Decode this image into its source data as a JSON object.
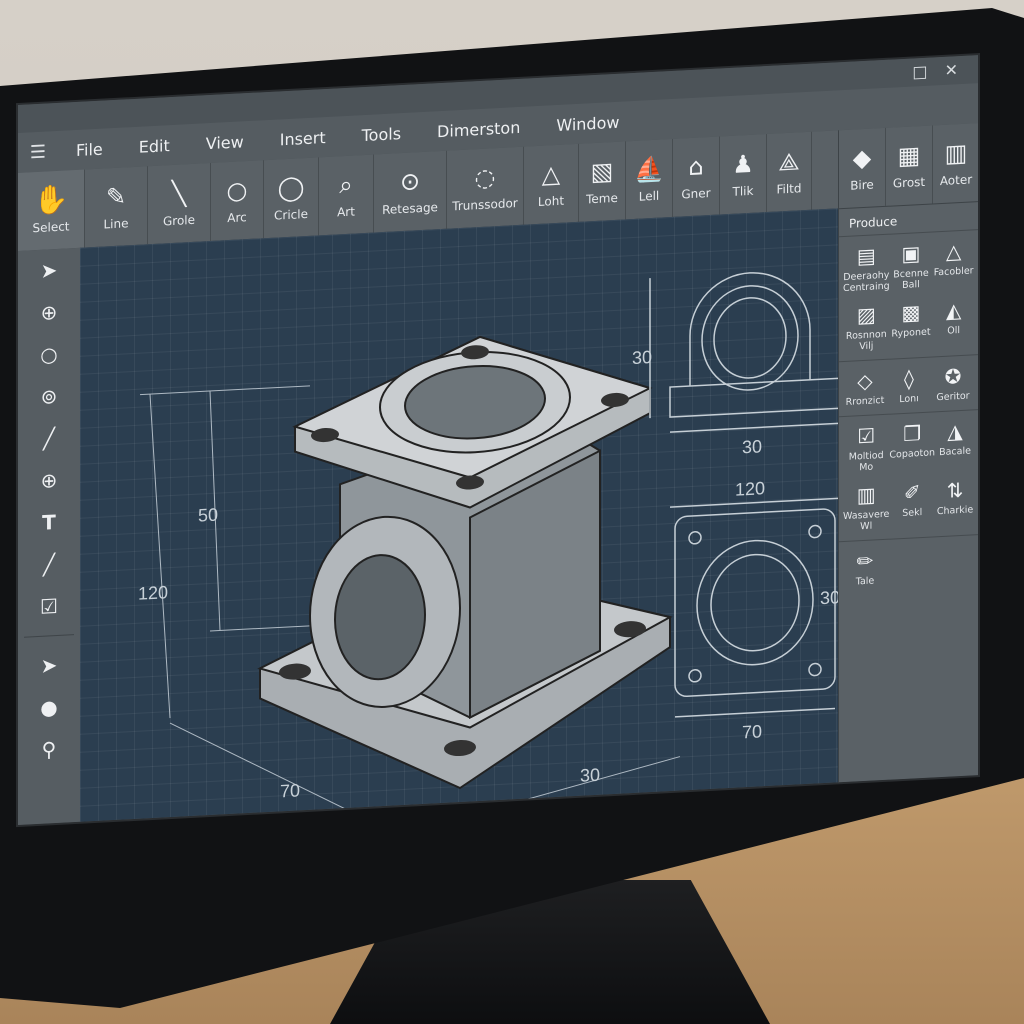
{
  "window": {
    "controls": "□ ✕"
  },
  "menu": {
    "hamburger_icon": "menu-icon",
    "items": [
      "File",
      "Edit",
      "View",
      "Insert",
      "Tools",
      "Dimerston",
      "Window"
    ]
  },
  "toolbar": {
    "tools": [
      {
        "label": "Select",
        "icon": "select-hand-icon",
        "glyph": "✋"
      },
      {
        "label": "Line",
        "icon": "line-pen-icon",
        "glyph": "✎"
      },
      {
        "label": "Grole",
        "icon": "diagonal-line-icon",
        "glyph": "╲"
      },
      {
        "label": "Arc",
        "icon": "circle-icon",
        "glyph": "○"
      },
      {
        "label": "Cricle",
        "icon": "circle-dot-icon",
        "glyph": "◯"
      },
      {
        "label": "Art",
        "icon": "magnifier-icon",
        "glyph": "⌕"
      },
      {
        "label": "Retesage",
        "icon": "zoom-circle-icon",
        "glyph": "⊙"
      },
      {
        "label": "Trunssodor",
        "icon": "dotted-circle-icon",
        "glyph": "◌"
      },
      {
        "label": "Loht",
        "icon": "triangle-warning-icon",
        "glyph": "△"
      },
      {
        "label": "Teme",
        "icon": "document-flag-icon",
        "glyph": "▧"
      },
      {
        "label": "Lell",
        "icon": "sail-icon",
        "glyph": "⛵"
      },
      {
        "label": "Gner",
        "icon": "roof-icon",
        "glyph": "⌂"
      },
      {
        "label": "Tlik",
        "icon": "person-icon",
        "glyph": "♟"
      },
      {
        "label": "Filtd",
        "icon": "filter-icon",
        "glyph": "⟁"
      },
      {
        "label": "Bire",
        "icon": "prism-icon",
        "glyph": "◆"
      },
      {
        "label": "Grost",
        "icon": "grid-shapes-icon",
        "glyph": "▦"
      },
      {
        "label": "Aoter",
        "icon": "blocks-icon",
        "glyph": "▥"
      }
    ]
  },
  "left_tools": [
    {
      "icon": "arrow-pointer-icon",
      "glyph": "➤"
    },
    {
      "icon": "crosshair-circle-icon",
      "glyph": "⊕"
    },
    {
      "icon": "circle-outline-icon",
      "glyph": "○"
    },
    {
      "icon": "target-circle-icon",
      "glyph": "⊚"
    },
    {
      "icon": "pen-line-icon",
      "glyph": "╱"
    },
    {
      "icon": "zoom-in-icon",
      "glyph": "⊕"
    },
    {
      "icon": "text-tool-icon",
      "glyph": "T"
    },
    {
      "icon": "slash-line-icon",
      "glyph": "╱"
    },
    {
      "icon": "checkbox-icon",
      "glyph": "☑"
    },
    {
      "icon": "arrow-select-icon",
      "glyph": "➤"
    },
    {
      "icon": "filled-dot-icon",
      "glyph": "●"
    },
    {
      "icon": "search-icon",
      "glyph": "⚲"
    }
  ],
  "right_panel": {
    "header": "Produce",
    "groups": [
      [
        {
          "label": "Deeraohy Centraing",
          "icon": "document-icon",
          "glyph": "▤"
        },
        {
          "label": "Bcenne Ball",
          "icon": "page-edit-icon",
          "glyph": "▣"
        },
        {
          "label": "Facobler",
          "icon": "triangle-outline-icon",
          "glyph": "△"
        },
        {
          "label": "Rosnnon Vilj",
          "icon": "note-icon",
          "glyph": "▨"
        },
        {
          "label": "Ryponet",
          "icon": "doc-stack-icon",
          "glyph": "▩"
        },
        {
          "label": "Oll",
          "icon": "sail-small-icon",
          "glyph": "◭"
        }
      ],
      [
        {
          "label": "Rronzict",
          "icon": "diamond-icon",
          "glyph": "◇"
        },
        {
          "label": "Lonı",
          "icon": "rhombus-icon",
          "glyph": "◊"
        },
        {
          "label": "Geritor",
          "icon": "gear-circle-icon",
          "glyph": "✪"
        }
      ],
      [
        {
          "label": "Moltiod Mo",
          "icon": "check-doc-icon",
          "glyph": "☑"
        },
        {
          "label": "Copaoton",
          "icon": "copy-icon",
          "glyph": "❐"
        },
        {
          "label": "Bacale",
          "icon": "sails-icon",
          "glyph": "◮"
        },
        {
          "label": "Wasavere Wl",
          "icon": "clipboard-icon",
          "glyph": "▥"
        },
        {
          "label": "Sekl",
          "icon": "brush-icon",
          "glyph": "✐"
        },
        {
          "label": "Charkie",
          "icon": "pin-icon",
          "glyph": "⇅"
        }
      ],
      [
        {
          "label": "Tale",
          "icon": "pencil-icon",
          "glyph": "✏"
        }
      ]
    ]
  },
  "drawing": {
    "dimensions": {
      "height_total": "120",
      "height_inner": "50",
      "width_front": "70",
      "depth": "30",
      "top_view_width": "120",
      "top_view_side": "30",
      "top_view_bottom": "70",
      "side_view_height": "30",
      "side_view_width": "30"
    }
  }
}
